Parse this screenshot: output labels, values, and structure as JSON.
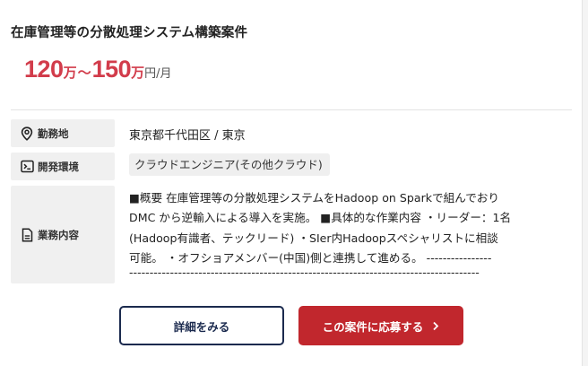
{
  "job": {
    "title": "在庫管理等の分散処理システム構築案件",
    "salary": {
      "min": "120",
      "max": "150",
      "man": "万",
      "tilde": "～",
      "unit": "円/月"
    },
    "location_label": "勤務地",
    "location_value": "東京都千代田区 / 東京",
    "env_label": "開発環境",
    "env_tag": "クラウドエンジニア(その他クラウド)",
    "desc_label": "業務内容",
    "desc_lines": [
      "■概要 在庫管理等の分散処理システムをHadoop on Sparkで組んでおり",
      "DMC から逆輸入による導入を実施。 ■具体的な作業内容 ・リーダー：1名",
      "(Hadoop有識者、テックリード) ・SIer内Hadoopスペシャリストに相談",
      "可能。 ・オフショアメンバー(中国)側と連携して進める。 ----------------",
      "--------------------------------------------------------------------------------------"
    ]
  },
  "buttons": {
    "detail_label": "詳細をみる",
    "apply_label": "この案件に応募する"
  },
  "icons": {
    "location": "map-pin-icon",
    "env": "terminal-icon",
    "desc": "document-icon",
    "arrow": "chevron-right-icon"
  },
  "colors": {
    "accent_red": "#d23c4b",
    "apply_button": "#c1272d",
    "detail_border": "#1b2a4e",
    "label_bg": "#f0f0f0"
  }
}
